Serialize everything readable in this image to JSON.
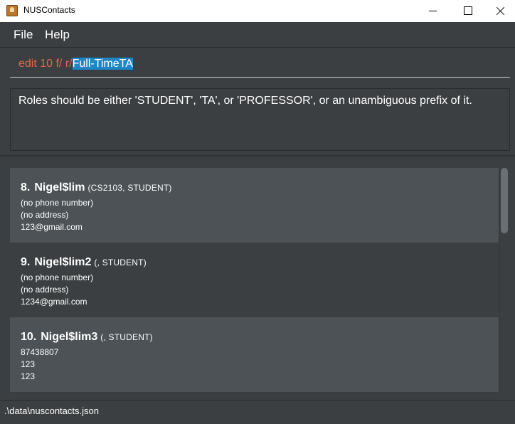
{
  "window": {
    "title": "NUSContacts"
  },
  "menu": {
    "file": "File",
    "help": "Help"
  },
  "command": {
    "plain_text": "edit 10 f/ r/",
    "selected_text": "Full-TimeTA"
  },
  "result": {
    "message": "Roles should be either 'STUDENT', 'TA', or 'PROFESSOR', or an unambiguous prefix of it."
  },
  "contacts": [
    {
      "index": "8.",
      "name": "Nigel$lim",
      "tags": "(CS2103, STUDENT)",
      "phone": "(no phone number)",
      "address": "(no address)",
      "email": "123@gmail.com"
    },
    {
      "index": "9.",
      "name": "Nigel$lim2",
      "tags": "(, STUDENT)",
      "phone": "(no phone number)",
      "address": "(no address)",
      "email": "1234@gmail.com"
    },
    {
      "index": "10.",
      "name": "Nigel$lim3",
      "tags": "(, STUDENT)",
      "phone": "87438807",
      "address": "123",
      "email": "123"
    }
  ],
  "status": {
    "path": ".\\data\\nuscontacts.json"
  },
  "icons": {
    "app": "contacts-app-icon",
    "minimize": "minimize-icon",
    "maximize": "maximize-icon",
    "close": "close-icon"
  }
}
